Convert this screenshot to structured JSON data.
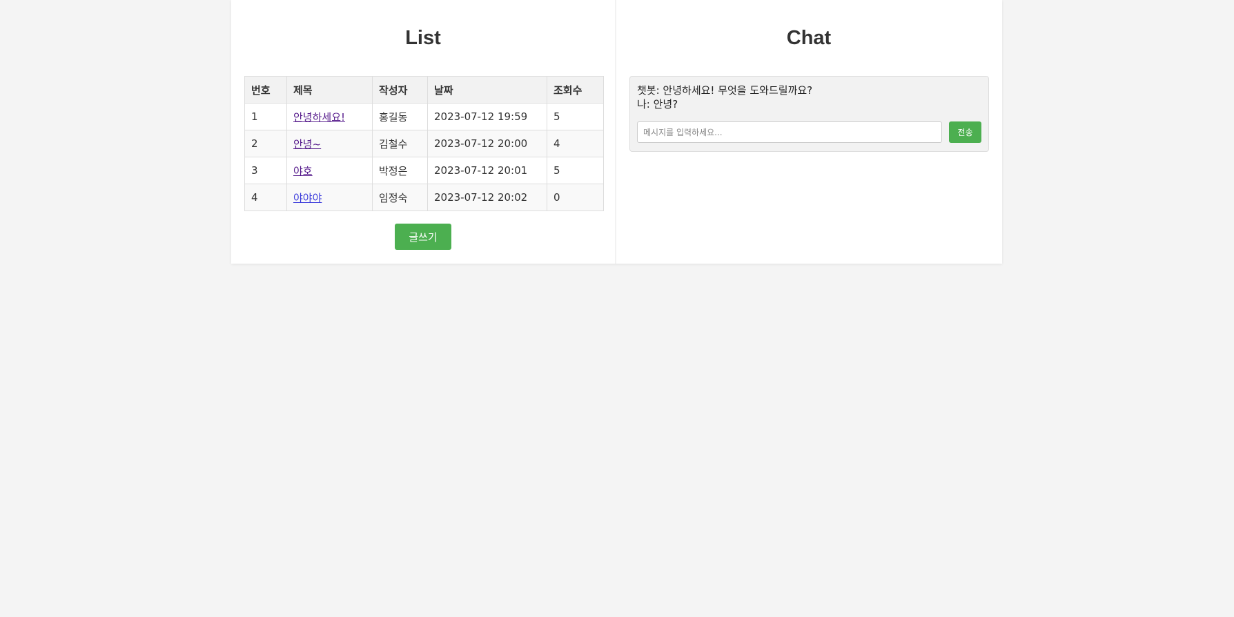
{
  "list": {
    "title": "List",
    "headers": [
      "번호",
      "제목",
      "작성자",
      "날짜",
      "조회수"
    ],
    "rows": [
      {
        "no": "1",
        "title": "안녕하세요!",
        "author": "홍길동",
        "date": "2023-07-12 19:59",
        "views": "5"
      },
      {
        "no": "2",
        "title": "안녕~",
        "author": "김철수",
        "date": "2023-07-12 20:00",
        "views": "4"
      },
      {
        "no": "3",
        "title": "야호",
        "author": "박정은",
        "date": "2023-07-12 20:01",
        "views": "5"
      },
      {
        "no": "4",
        "title": "야야야",
        "author": "임정숙",
        "date": "2023-07-12 20:02",
        "views": "0"
      }
    ],
    "write_button": "글쓰기"
  },
  "chat": {
    "title": "Chat",
    "messages": [
      "챗봇: 안녕하세요! 무엇을 도와드릴까요?",
      "나: 안녕?"
    ],
    "input_placeholder": "메시지를 입력하세요...",
    "input_value": "",
    "send_button": "전송"
  },
  "colors": {
    "accent": "#4caf50",
    "page_background": "#f4f4f4",
    "visited_link": "#551a8b",
    "link": "#3b3bdb"
  }
}
